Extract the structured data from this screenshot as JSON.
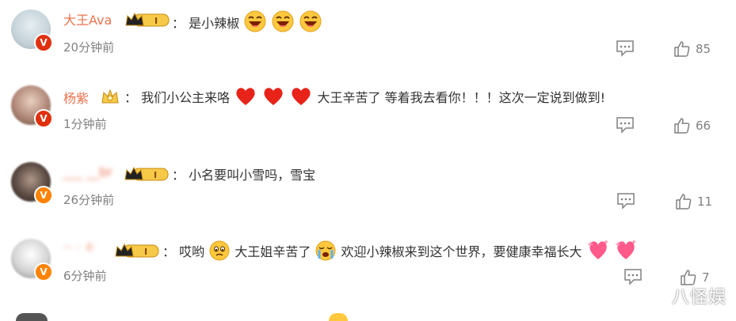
{
  "comments": [
    {
      "name": "大王Ava",
      "separator": "：",
      "text_parts": [
        "是小辣椒"
      ],
      "time": "20分钟前",
      "likes": "85",
      "badge": "V",
      "avatar_colors": [
        "#d8e6ec",
        "#a8b8c0"
      ]
    },
    {
      "name": "杨紫",
      "separator": "：",
      "text_a": "我们小公主来咯",
      "text_b": "大王辛苦了 等着我去看你！！！这次一定说到做到!",
      "time": "1分钟前",
      "likes": "66",
      "badge": "V",
      "avatar_colors": [
        "#c8a89a",
        "#7a5a50"
      ]
    },
    {
      "name": "___ __br",
      "separator": "：",
      "text": "小名要叫小雪吗，雪宝",
      "time": "26分钟前",
      "likes": "11",
      "badge": "V",
      "avatar_colors": [
        "#6a5a50",
        "#3a302a"
      ]
    },
    {
      "name": "·· · ·I·",
      "separator": "：",
      "text_a": "哎哟",
      "text_b": "大王姐辛苦了",
      "text_c": "欢迎小辣椒来到这个世界，要健康幸福长大",
      "time": "6分钟前",
      "likes": "7",
      "badge": "V",
      "avatar_colors": [
        "#f0f0f0",
        "#b0b0b0"
      ]
    }
  ],
  "watermark": "八怪娱",
  "colors": {
    "name": "#eb7350",
    "time": "#808080",
    "badge_orange": "#ff8200",
    "badge_red": "#e0300e"
  },
  "icons": [
    "crown-level-badge",
    "reply-icon",
    "thumbs-up-icon",
    "laugh-emoji",
    "heart-emoji",
    "sad-emoji",
    "crying-emoji",
    "sparkle-heart-emoji"
  ]
}
